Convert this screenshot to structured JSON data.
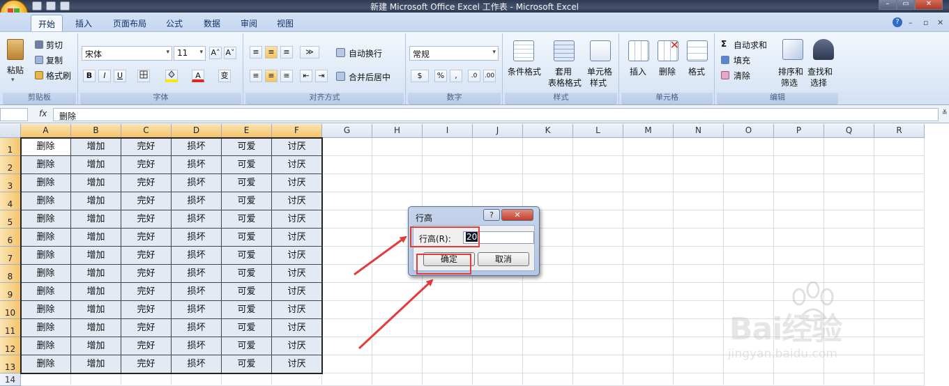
{
  "window": {
    "title": "新建 Microsoft Office Excel 工作表 - Microsoft Excel",
    "controls": {
      "minimize": "–",
      "restore": "▭",
      "close": "✕"
    },
    "doc_controls": {
      "help": "?",
      "minimize": "–",
      "restore": "▫",
      "close": "✕"
    }
  },
  "tabs": [
    {
      "label": "开始",
      "active": true
    },
    {
      "label": "插入"
    },
    {
      "label": "页面布局"
    },
    {
      "label": "公式"
    },
    {
      "label": "数据"
    },
    {
      "label": "审阅"
    },
    {
      "label": "视图"
    }
  ],
  "ribbon": {
    "clipboard": {
      "title": "剪贴板",
      "paste": "粘贴",
      "cut": "剪切",
      "copy": "复制",
      "format_painter": "格式刷"
    },
    "font": {
      "title": "字体",
      "name": "宋体",
      "size": "11",
      "grow": "A˄",
      "shrink": "A˅",
      "bold": "B",
      "italic": "I",
      "underline": "U",
      "phonetic": "变"
    },
    "alignment": {
      "title": "对齐方式",
      "wrap": "自动换行",
      "merge": "合并后居中"
    },
    "number": {
      "title": "数字",
      "format": "常规",
      "percent": "%",
      "comma": ","
    },
    "styles": {
      "title": "样式",
      "conditional": "条件格式",
      "table_line1": "套用",
      "table_line2": "表格格式",
      "cell_line1": "单元格",
      "cell_line2": "样式"
    },
    "cells": {
      "title": "单元格",
      "insert": "插入",
      "delete": "删除",
      "format": "格式"
    },
    "editing": {
      "title": "编辑",
      "autosum": "自动求和",
      "fill": "填充",
      "clear": "清除",
      "sort_line1": "排序和",
      "sort_line2": "筛选",
      "find_line1": "查找和",
      "find_line2": "选择"
    }
  },
  "formula_bar": {
    "fx": "fx",
    "value": "删除"
  },
  "sheet": {
    "columns": [
      "A",
      "B",
      "C",
      "D",
      "E",
      "F",
      "G",
      "H",
      "I",
      "J",
      "K",
      "L",
      "M",
      "N",
      "O",
      "P",
      "Q",
      "R"
    ],
    "rows": [
      "1",
      "2",
      "3",
      "4",
      "5",
      "6",
      "7",
      "8",
      "9",
      "10",
      "11",
      "12",
      "13",
      "14"
    ],
    "data_row": [
      "删除",
      "增加",
      "完好",
      "损坏",
      "可爱",
      "讨厌"
    ],
    "filled_rows": 13
  },
  "dialog": {
    "title": "行高",
    "help": "?",
    "close": "✕",
    "label": "行高(R):",
    "value": "20",
    "ok": "确定",
    "cancel": "取消"
  },
  "watermark": {
    "brand": "Bai经验",
    "url": "jingyan.baidu.com"
  }
}
